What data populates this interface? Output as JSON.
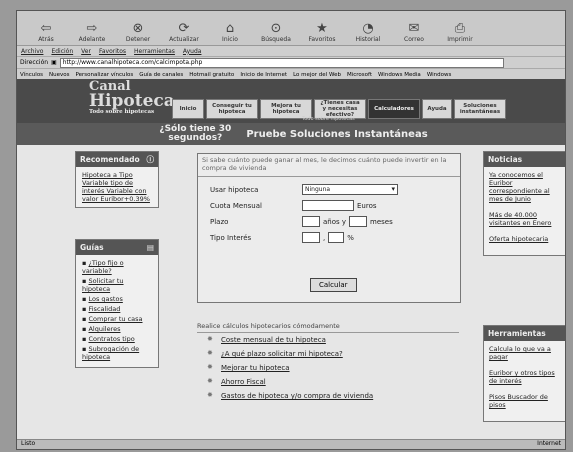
{
  "toolbar": {
    "buttons": [
      {
        "label": "Atrás",
        "icon": "back-arrow-icon"
      },
      {
        "label": "Adelante",
        "icon": "forward-arrow-icon"
      },
      {
        "label": "Detener",
        "icon": "stop-icon"
      },
      {
        "label": "Actualizar",
        "icon": "refresh-icon"
      },
      {
        "label": "Inicio",
        "icon": "home-icon"
      },
      {
        "label": "Búsqueda",
        "icon": "search-icon"
      },
      {
        "label": "Favoritos",
        "icon": "favorites-icon"
      },
      {
        "label": "Historial",
        "icon": "history-icon"
      },
      {
        "label": "Correo",
        "icon": "mail-icon"
      },
      {
        "label": "Imprimir",
        "icon": "print-icon"
      }
    ]
  },
  "menu": [
    "Archivo",
    "Edición",
    "Ver",
    "Favoritos",
    "Herramientas",
    "Ayuda"
  ],
  "address": {
    "label": "Dirección",
    "url": "http://www.canalhipoteca.com/calcimpota.php"
  },
  "links": {
    "label": "Vínculos",
    "items": [
      "Nuevos",
      "Personalizar vínculos",
      "Guía de canales",
      "Hotmail gratuito",
      "Inicio de Internet",
      "Lo mejor del Web",
      "Microsoft",
      "Windows Media",
      "Windows"
    ]
  },
  "site": {
    "logo": {
      "line1": "Canal",
      "line2": "Hipoteca",
      "tagline": "Todo sobre hipotecas"
    },
    "nav": [
      {
        "label": "Inicio"
      },
      {
        "label": "Conseguir tu hipoteca"
      },
      {
        "label": "Mejora tu hipoteca"
      },
      {
        "label": "¿Tienes casa y necesitas efectivo?"
      },
      {
        "label": "Calculadores",
        "active": true
      },
      {
        "label": "Ayuda"
      },
      {
        "label": "Soluciones instantáneas"
      }
    ],
    "nav_sub": "Todo sobre hipotecas",
    "promo": {
      "question": "¿Sólo tiene 30 segundos?",
      "cta": "Pruebe Soluciones Instantáneas"
    }
  },
  "left": {
    "recomendado": {
      "title": "Recomendado",
      "text": "Hipoteca a Tipo Variable tipo de interés Variable con valor Euribor+0.39%"
    },
    "guias": {
      "title": "Guías",
      "items": [
        "¿Tipo fijo o variable?",
        "Solicitar tu hipoteca",
        "Los gastos",
        "Fiscalidad",
        "Comprar tu casa",
        "Alquileres",
        "Contratos tipo",
        "Subrogación de hipoteca"
      ]
    }
  },
  "form": {
    "intro": "Si sabe cuánto puede ganar al mes, le decimos cuánto puede invertir en la compra de vivienda",
    "usar_label": "Usar hipoteca",
    "usar_value": "Ninguna",
    "cuota_label": "Cuota Mensual",
    "cuota_unit": "Euros",
    "plazo_label": "Plazo",
    "plazo_years": "años y",
    "plazo_months": "meses",
    "interes_label": "Tipo Interés",
    "interes_sep": ",",
    "interes_unit": "%",
    "button": "Calcular"
  },
  "list": {
    "title": "Realice cálculos hipotecarios cómodamente",
    "items": [
      "Coste mensual de tu hipoteca",
      "¿A qué plazo solicitar mi hipoteca?",
      "Mejorar tu hipoteca",
      "Ahorro Fiscal",
      "Gastos de hipoteca y/o compra de vivienda"
    ]
  },
  "right": {
    "noticias": {
      "title": "Noticias",
      "items": [
        "Ya conocemos el Euribor correspondiente al mes de Junio",
        "Más de 40.000 visitantes en Enero",
        "Oferta hipotecaria"
      ]
    },
    "herramientas": {
      "title": "Herramientas",
      "items": [
        "Calcula lo que va a pagar",
        "Euribor y otros tipos de interés",
        "Pisos Buscador de pisos"
      ]
    }
  },
  "status": {
    "left": "Listo",
    "right": "Internet"
  }
}
